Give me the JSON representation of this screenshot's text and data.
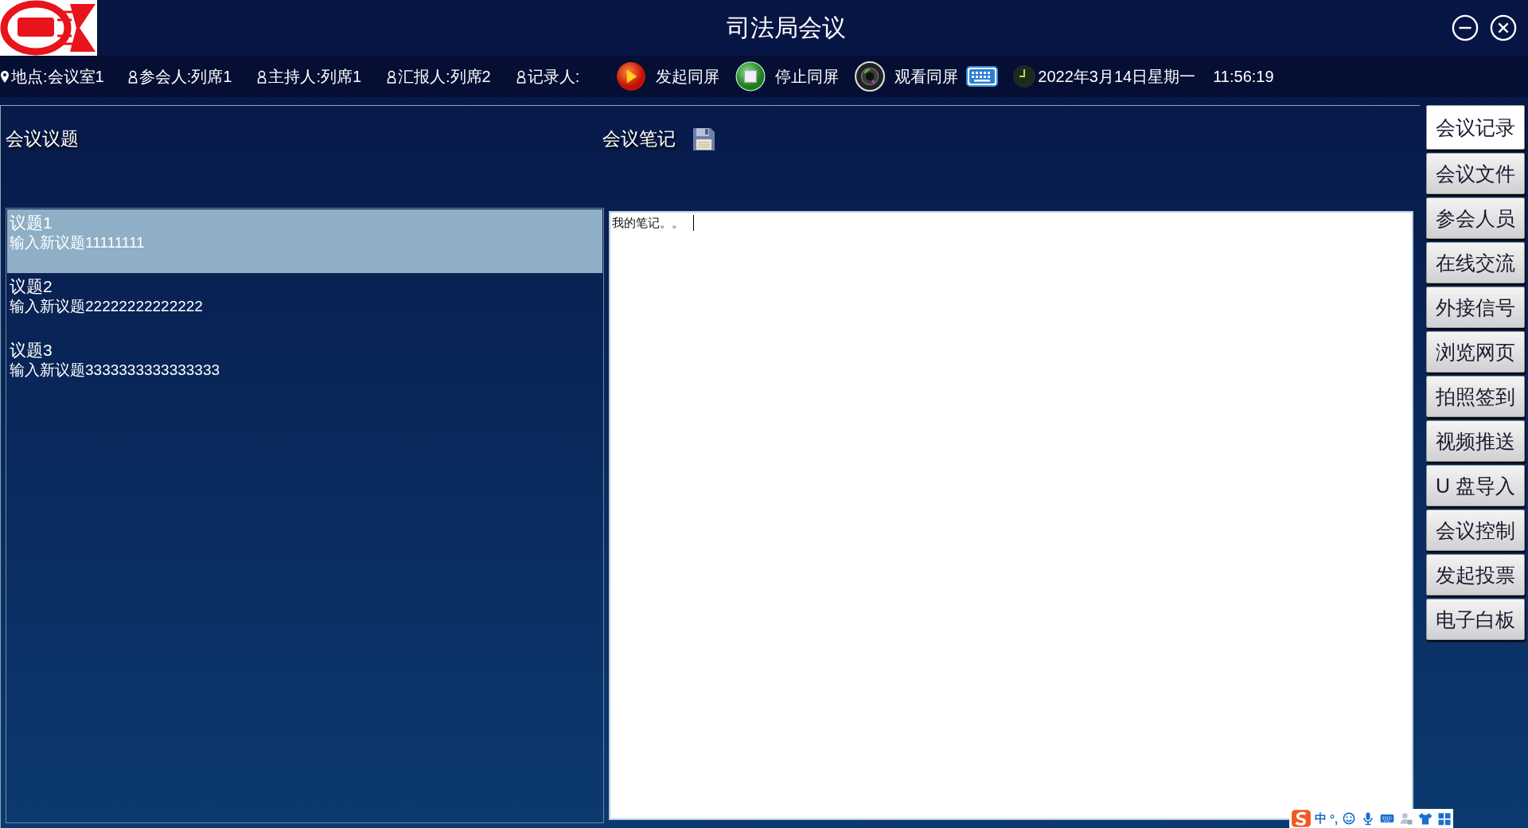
{
  "window": {
    "title": "司法局会议"
  },
  "info_bar": {
    "items": [
      {
        "kind": "location",
        "text": "地点:会议室1"
      },
      {
        "kind": "person",
        "text": "参会人:列席1"
      },
      {
        "kind": "person",
        "text": "主持人:列席1"
      },
      {
        "kind": "person",
        "text": "汇报人:列席2"
      },
      {
        "kind": "person",
        "text": "记录人:"
      }
    ],
    "actions": [
      {
        "kind": "play",
        "label": "发起同屏"
      },
      {
        "kind": "stop",
        "label": "停止同屏"
      },
      {
        "kind": "camera",
        "label": "观看同屏"
      }
    ],
    "date": "2022年3月14日星期一",
    "time": "11:56:19"
  },
  "topics": {
    "heading": "会议议题",
    "items": [
      {
        "title": "议题1",
        "text": "输入新议题11111111",
        "selected": true
      },
      {
        "title": "议题2",
        "text": "输入新议题22222222222222",
        "selected": false
      },
      {
        "title": "议题3",
        "text": "输入新议题3333333333333333",
        "selected": false
      }
    ]
  },
  "notes": {
    "heading": "会议笔记",
    "value": "我的笔记。。"
  },
  "sidebar": {
    "items": [
      {
        "label": "会议记录",
        "selected": true
      },
      {
        "label": "会议文件",
        "selected": false
      },
      {
        "label": "参会人员",
        "selected": false
      },
      {
        "label": "在线交流",
        "selected": false
      },
      {
        "label": "外接信号",
        "selected": false
      },
      {
        "label": "浏览网页",
        "selected": false
      },
      {
        "label": "拍照签到",
        "selected": false
      },
      {
        "label": "视频推送",
        "selected": false
      },
      {
        "label": "U 盘导入",
        "selected": false
      },
      {
        "label": "会议控制",
        "selected": false
      },
      {
        "label": "发起投票",
        "selected": false
      },
      {
        "label": "电子白板",
        "selected": false
      }
    ]
  },
  "ime_bar": {
    "items": [
      {
        "kind": "logo"
      },
      {
        "kind": "text",
        "text": "中"
      },
      {
        "kind": "text",
        "text": "°,"
      },
      {
        "kind": "smile"
      },
      {
        "kind": "mic"
      },
      {
        "kind": "keyboard"
      },
      {
        "kind": "user"
      },
      {
        "kind": "shirt"
      },
      {
        "kind": "grid"
      }
    ]
  }
}
